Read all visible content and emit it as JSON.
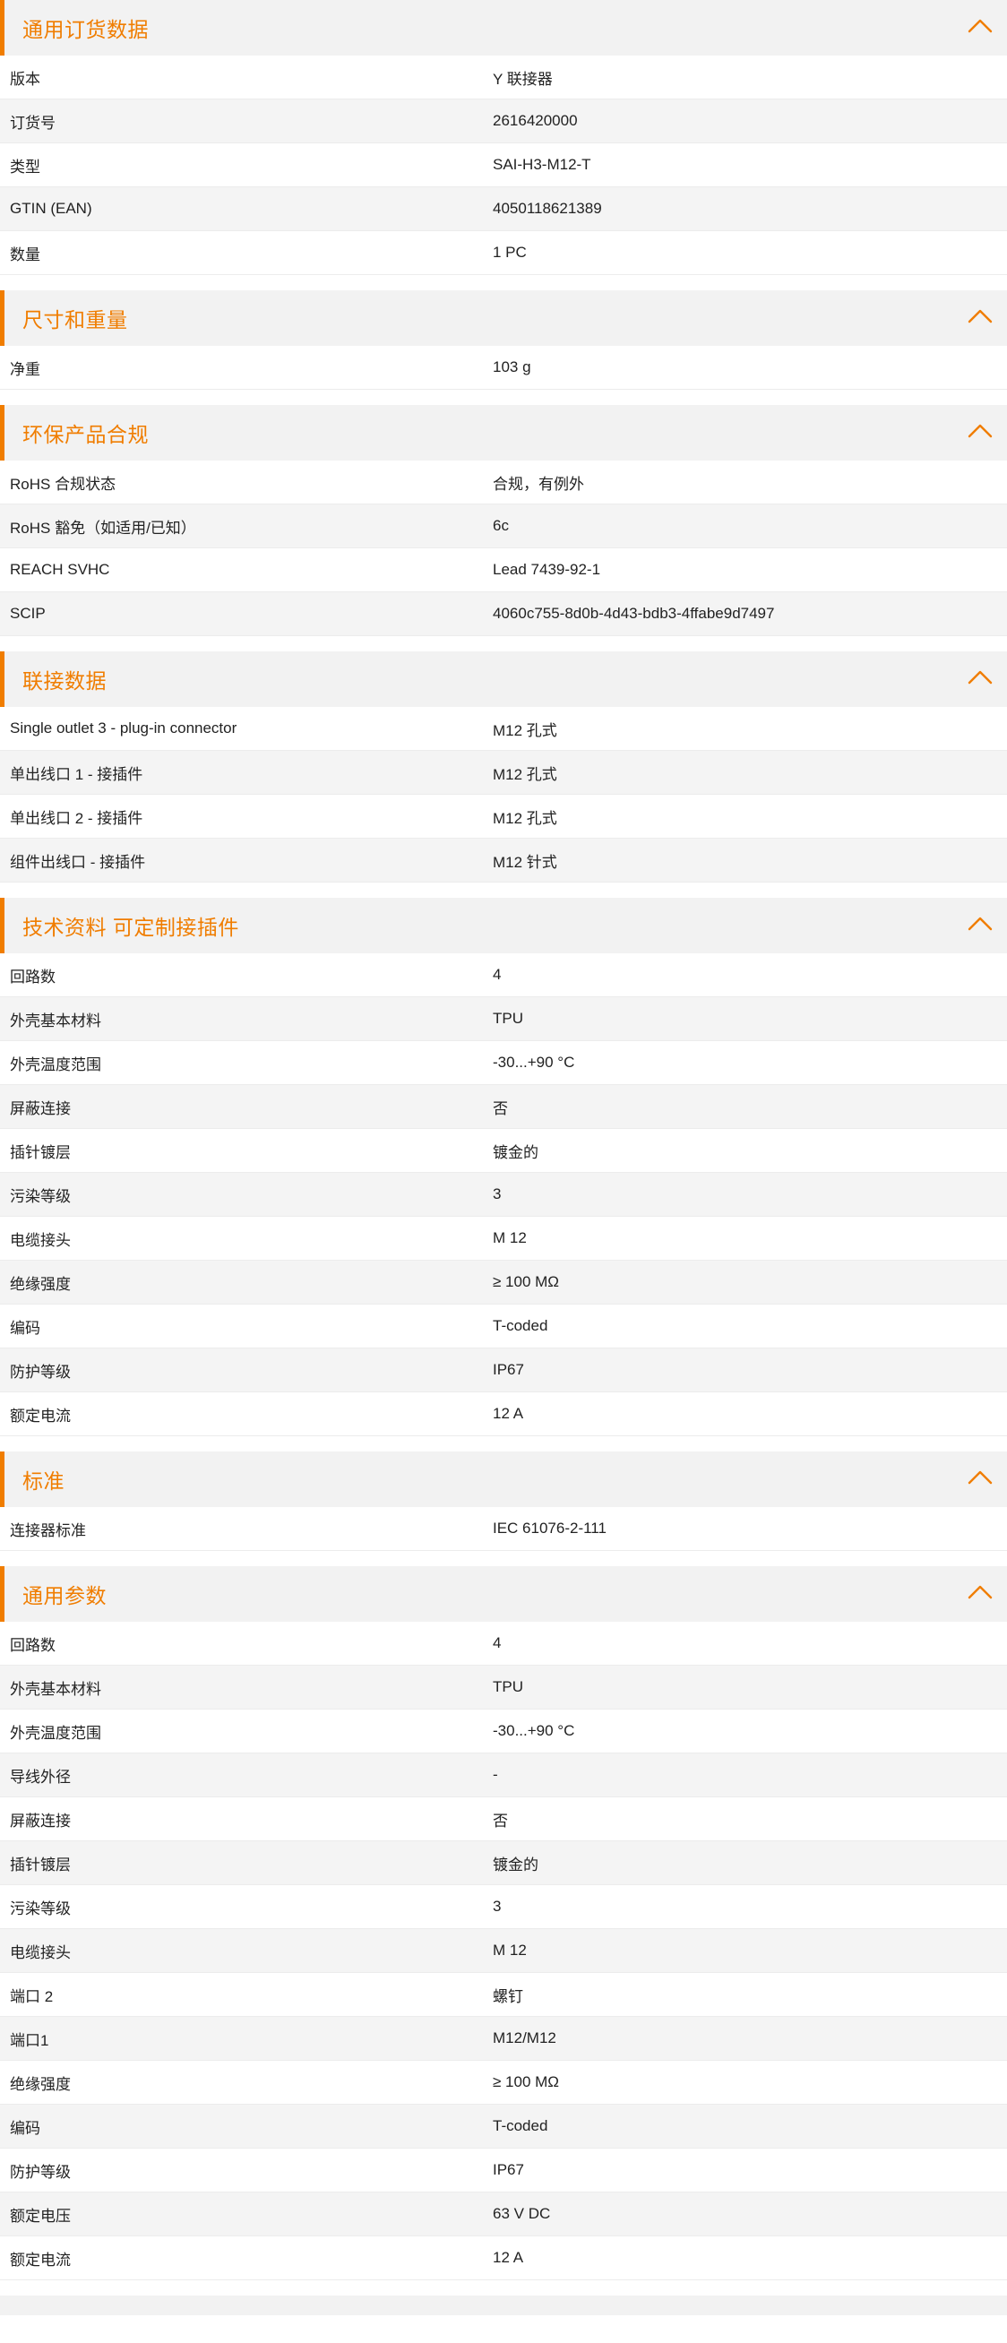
{
  "accent_color": "#f07d00",
  "sections": [
    {
      "title": "通用订货数据",
      "icon": "chevron-up-icon",
      "rows": [
        {
          "label": "版本",
          "value": "Y 联接器"
        },
        {
          "label": "订货号",
          "value": "2616420000"
        },
        {
          "label": "类型",
          "value": "SAI-H3-M12-T"
        },
        {
          "label": "GTIN (EAN)",
          "value": "4050118621389"
        },
        {
          "label": "数量",
          "value": "1  PC"
        }
      ]
    },
    {
      "title": "尺寸和重量",
      "icon": "chevron-up-icon",
      "rows": [
        {
          "label": "净重",
          "value": "103  g"
        }
      ]
    },
    {
      "title": "环保产品合规",
      "icon": "chevron-up-icon",
      "rows": [
        {
          "label": "RoHS 合规状态",
          "value": "合规，有例外"
        },
        {
          "label": "RoHS 豁免（如适用/已知）",
          "value": "6c"
        },
        {
          "label": "REACH SVHC",
          "value": "Lead 7439-92-1"
        },
        {
          "label": "SCIP",
          "value": "4060c755-8d0b-4d43-bdb3-4ffabe9d7497"
        }
      ]
    },
    {
      "title": "联接数据",
      "icon": "chevron-up-icon",
      "rows": [
        {
          "label": "Single outlet 3 - plug-in connector",
          "value": "M12 孔式"
        },
        {
          "label": "单出线口 1 - 接插件",
          "value": "M12 孔式"
        },
        {
          "label": "单出线口 2 - 接插件",
          "value": "M12 孔式"
        },
        {
          "label": "组件出线口 - 接插件",
          "value": "M12 针式"
        }
      ]
    },
    {
      "title": "技术资料 可定制接插件",
      "icon": "chevron-up-icon",
      "rows": [
        {
          "label": "回路数",
          "value": "4"
        },
        {
          "label": "外壳基本材料",
          "value": "TPU"
        },
        {
          "label": "外壳温度范围",
          "value": "-30...+90 °C"
        },
        {
          "label": "屏蔽连接",
          "value": "否"
        },
        {
          "label": "插针镀层",
          "value": "镀金的"
        },
        {
          "label": "污染等级",
          "value": "3"
        },
        {
          "label": "电缆接头",
          "value": "M 12"
        },
        {
          "label": "绝缘强度",
          "value": "≥ 100 MΩ"
        },
        {
          "label": "编码",
          "value": "T-coded"
        },
        {
          "label": "防护等级",
          "value": "IP67"
        },
        {
          "label": "额定电流",
          "value": "12  A"
        }
      ]
    },
    {
      "title": "标准",
      "icon": "chevron-up-icon",
      "rows": [
        {
          "label": "连接器标准",
          "value": "IEC 61076-2-111"
        }
      ]
    },
    {
      "title": "通用参数",
      "icon": "chevron-up-icon",
      "rows": [
        {
          "label": "回路数",
          "value": "4"
        },
        {
          "label": "外壳基本材料",
          "value": "TPU"
        },
        {
          "label": "外壳温度范围",
          "value": "-30...+90 °C"
        },
        {
          "label": "导线外径",
          "value": "-"
        },
        {
          "label": "屏蔽连接",
          "value": "否"
        },
        {
          "label": "插针镀层",
          "value": "镀金的"
        },
        {
          "label": "污染等级",
          "value": "3"
        },
        {
          "label": "电缆接头",
          "value": "M 12"
        },
        {
          "label": "端口 2",
          "value": "螺钉"
        },
        {
          "label": "端口1",
          "value": "M12/M12"
        },
        {
          "label": "绝缘强度",
          "value": "≥ 100 MΩ"
        },
        {
          "label": "编码",
          "value": "T-coded"
        },
        {
          "label": "防护等级",
          "value": "IP67"
        },
        {
          "label": "额定电压",
          "value": "63 V DC"
        },
        {
          "label": "额定电流",
          "value": "12  A"
        }
      ]
    }
  ]
}
